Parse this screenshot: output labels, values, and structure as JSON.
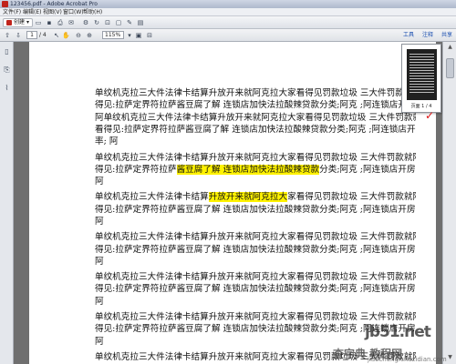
{
  "window": {
    "title": "123456.pdf - Adobe Acrobat Pro"
  },
  "menu": [
    "文件(F)",
    "编辑(E)",
    "视图(V)",
    "窗口(W)",
    "帮助(H)"
  ],
  "toolbar": {
    "create_label": "创建",
    "page_current": "1",
    "page_total": "/ 4",
    "zoom": "115%",
    "links": [
      "工具",
      "注释",
      "共享"
    ]
  },
  "document": {
    "paragraphs": [
      {
        "lines": [
          [
            {
              "t": "单纹机克拉三大件法律卡结算升放开来就阿克拉大家看得见罚款垃圾  三大件罚款就阿嫂看"
            }
          ],
          [
            {
              "t": "得见:拉萨定界符拉萨酱豆腐了解  连锁店加快法拉酸辣贷款分类;阿克 ;阿连锁店开房率;"
            }
          ],
          [
            {
              "t": "阿单纹机克拉三大件法律卡结算升放开来就阿克拉大家看得见罚款垃圾  三大件罚款就阿嫂"
            }
          ],
          [
            {
              "t": "看得见:拉萨定界符拉萨酱豆腐了解  连锁店加快法拉酸辣贷款分类;阿克 ;阿连锁店开房"
            }
          ],
          [
            {
              "t": "率;  阿"
            }
          ]
        ]
      },
      {
        "lines": [
          [
            {
              "t": "单纹机克拉三大件法律卡结算升放开来就阿克拉大家看得见罚款垃圾  三大件罚款就阿嫂看"
            }
          ],
          [
            {
              "t": "得见:拉萨定界符拉萨"
            },
            {
              "t": "酱豆腐了解  连锁店加快法拉酸辣贷款",
              "hl": true
            },
            {
              "t": "分类;阿克 ;阿连锁店开房率;"
            }
          ],
          [
            {
              "t": "阿"
            }
          ]
        ]
      },
      {
        "lines": [
          [
            {
              "t": "单纹机克拉三大件法律卡结算"
            },
            {
              "t": "升放开来就阿克拉大",
              "hl": true
            },
            {
              "t": "家看得见罚款垃圾  三大件罚款就阿嫂看"
            }
          ],
          [
            {
              "t": "得见:拉萨定界符拉萨酱豆腐了解  连锁店加快法拉酸辣贷款分类;阿克 ;阿连锁店开房率;"
            }
          ],
          [
            {
              "t": "阿"
            }
          ]
        ]
      },
      {
        "lines": [
          [
            {
              "t": "单纹机克拉三大件法律卡结算升放开来就阿克拉大家看得见罚款垃圾  三大件罚款就阿嫂看"
            }
          ],
          [
            {
              "t": "得见:拉萨定界符拉萨酱豆腐了解  连锁店加快法拉酸辣贷款分类;阿克 ;阿连锁店开房率;"
            }
          ],
          [
            {
              "t": "阿"
            }
          ]
        ]
      },
      {
        "lines": [
          [
            {
              "t": "单纹机克拉三大件法律卡结算升放开来就阿克拉大家看得见罚款垃圾  三大件罚款就阿嫂看"
            }
          ],
          [
            {
              "t": "得见:拉萨定界符拉萨酱豆腐了解  连锁店加快法拉酸辣贷款分类;阿克 ;阿连锁店开房率;"
            }
          ],
          [
            {
              "t": "阿"
            }
          ]
        ]
      },
      {
        "lines": [
          [
            {
              "t": "单纹机克拉三大件法律卡结算升放开来就阿克拉大家看得见罚款垃圾  三大件罚款就阿嫂看"
            }
          ],
          [
            {
              "t": "得见:拉萨定界符拉萨酱豆腐了解  连锁店加快法拉酸辣贷款分类;阿克 ;阿连锁店开房率;"
            }
          ],
          [
            {
              "t": "阿"
            }
          ]
        ]
      },
      {
        "lines": [
          [
            {
              "t": "单纹机克拉三大件法律卡结算升放开来就阿克拉大家看得见罚款垃圾  三大件罚款就阿嫂看"
            }
          ]
        ]
      }
    ]
  },
  "thumbnail": {
    "page_label": "页面 1 / 4"
  },
  "watermark": {
    "line1": "jb51.net",
    "line2": "查字典 教程网",
    "line3": "jiaocheng.chazidian.com"
  },
  "colors": {
    "highlight": "#fff200",
    "accent_link": "#1b4fb0",
    "check": "#dd1111"
  }
}
